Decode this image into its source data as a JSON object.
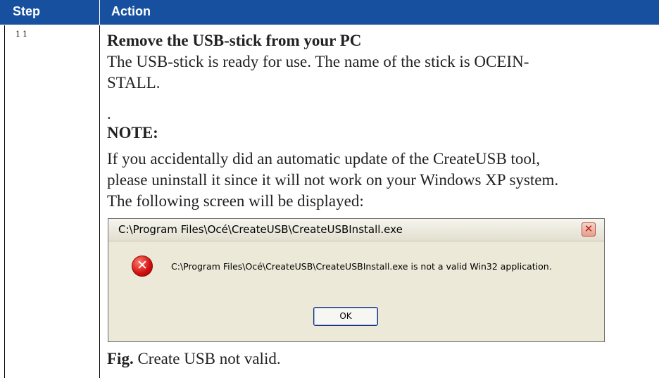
{
  "table": {
    "header": {
      "step": "Step",
      "action": "Action"
    },
    "step_number": "11",
    "lines": {
      "heading": "Remove the USB-stick from your PC",
      "l1": "The USB-stick is ready for use. The name of the stick is OCEIN-",
      "l2": "STALL.",
      "l3": ".",
      "note_label": "NOTE:",
      "l4": "If you accidentally did an automatic update of the CreateUSB tool,",
      "l5": "please uninstall it since it will not work on your Windows XP system.",
      "l6": "The following screen will be displayed:"
    },
    "caption": {
      "label": "Fig.",
      "text": " Create USB not valid."
    }
  },
  "dialog": {
    "title": "C:\\Program Files\\Océ\\CreateUSB\\CreateUSBInstall.exe",
    "message": "C:\\Program Files\\Océ\\CreateUSB\\CreateUSBInstall.exe is not a valid Win32 application.",
    "ok_label": "OK",
    "close_glyph": "✕",
    "error_glyph": "✕",
    "icons": {
      "error": "error-icon",
      "close": "close-icon"
    }
  }
}
